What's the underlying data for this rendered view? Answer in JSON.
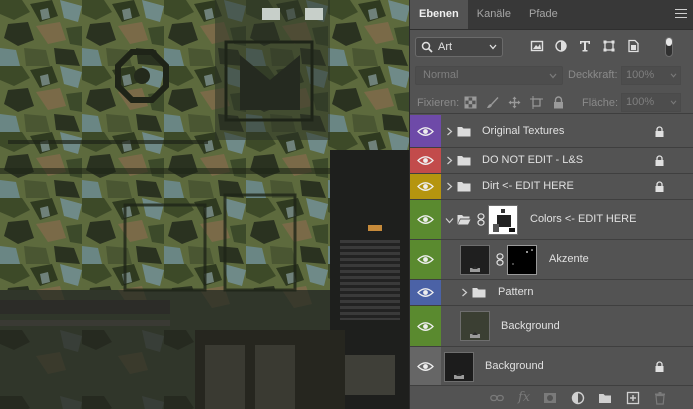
{
  "tabs": [
    {
      "label": "Ebenen",
      "active": true
    },
    {
      "label": "Kanäle",
      "active": false
    },
    {
      "label": "Pfade",
      "active": false
    }
  ],
  "filter": {
    "kind": "Art",
    "icons": [
      "image-filter-icon",
      "adjustment-filter-icon",
      "type-filter-icon",
      "shape-filter-icon",
      "smartobject-filter-icon"
    ],
    "toggle_on": true
  },
  "blend": {
    "mode": "Normal",
    "opacity_label": "Deckkraft:",
    "opacity": "100%"
  },
  "lock": {
    "label": "Fixieren:",
    "icons": [
      "lock-transparent-icon",
      "lock-image-icon",
      "lock-position-icon",
      "lock-artboard-icon",
      "lock-all-icon"
    ],
    "fill_label": "Fläche:",
    "fill": "100%"
  },
  "layers": [
    {
      "name": "Original Textures",
      "kind": "group",
      "color": "#6e4aa8",
      "expanded": false,
      "locked": true
    },
    {
      "name": "DO NOT EDIT  - L&S",
      "kind": "group",
      "color": "#c24b4b",
      "expanded": false,
      "locked": true
    },
    {
      "name": "Dirt <- EDIT HERE",
      "kind": "group",
      "color": "#b5950f",
      "expanded": false,
      "locked": true
    },
    {
      "name": "Colors <- EDIT HERE",
      "kind": "group-masked",
      "color": "#5a8a2f",
      "expanded": true,
      "locked": false
    },
    {
      "name": "Akzente",
      "kind": "layer-masked",
      "color": "#5a8a2f",
      "expanded": false,
      "locked": false
    },
    {
      "name": "Pattern",
      "kind": "group",
      "color": "#4b62a6",
      "expanded": false,
      "locked": false
    },
    {
      "name": "Background",
      "kind": "layer",
      "color": "#5a8a2f",
      "expanded": false,
      "locked": false
    },
    {
      "name": "Background",
      "kind": "layer",
      "color": "#666666",
      "expanded": false,
      "locked": true
    }
  ],
  "bottom_icons": [
    "link-layers-icon",
    "fx-icon",
    "add-mask-icon",
    "adjustment-layer-icon",
    "new-group-icon",
    "new-layer-icon",
    "trash-icon"
  ],
  "bottom_labels": {
    "fx": "fx"
  }
}
